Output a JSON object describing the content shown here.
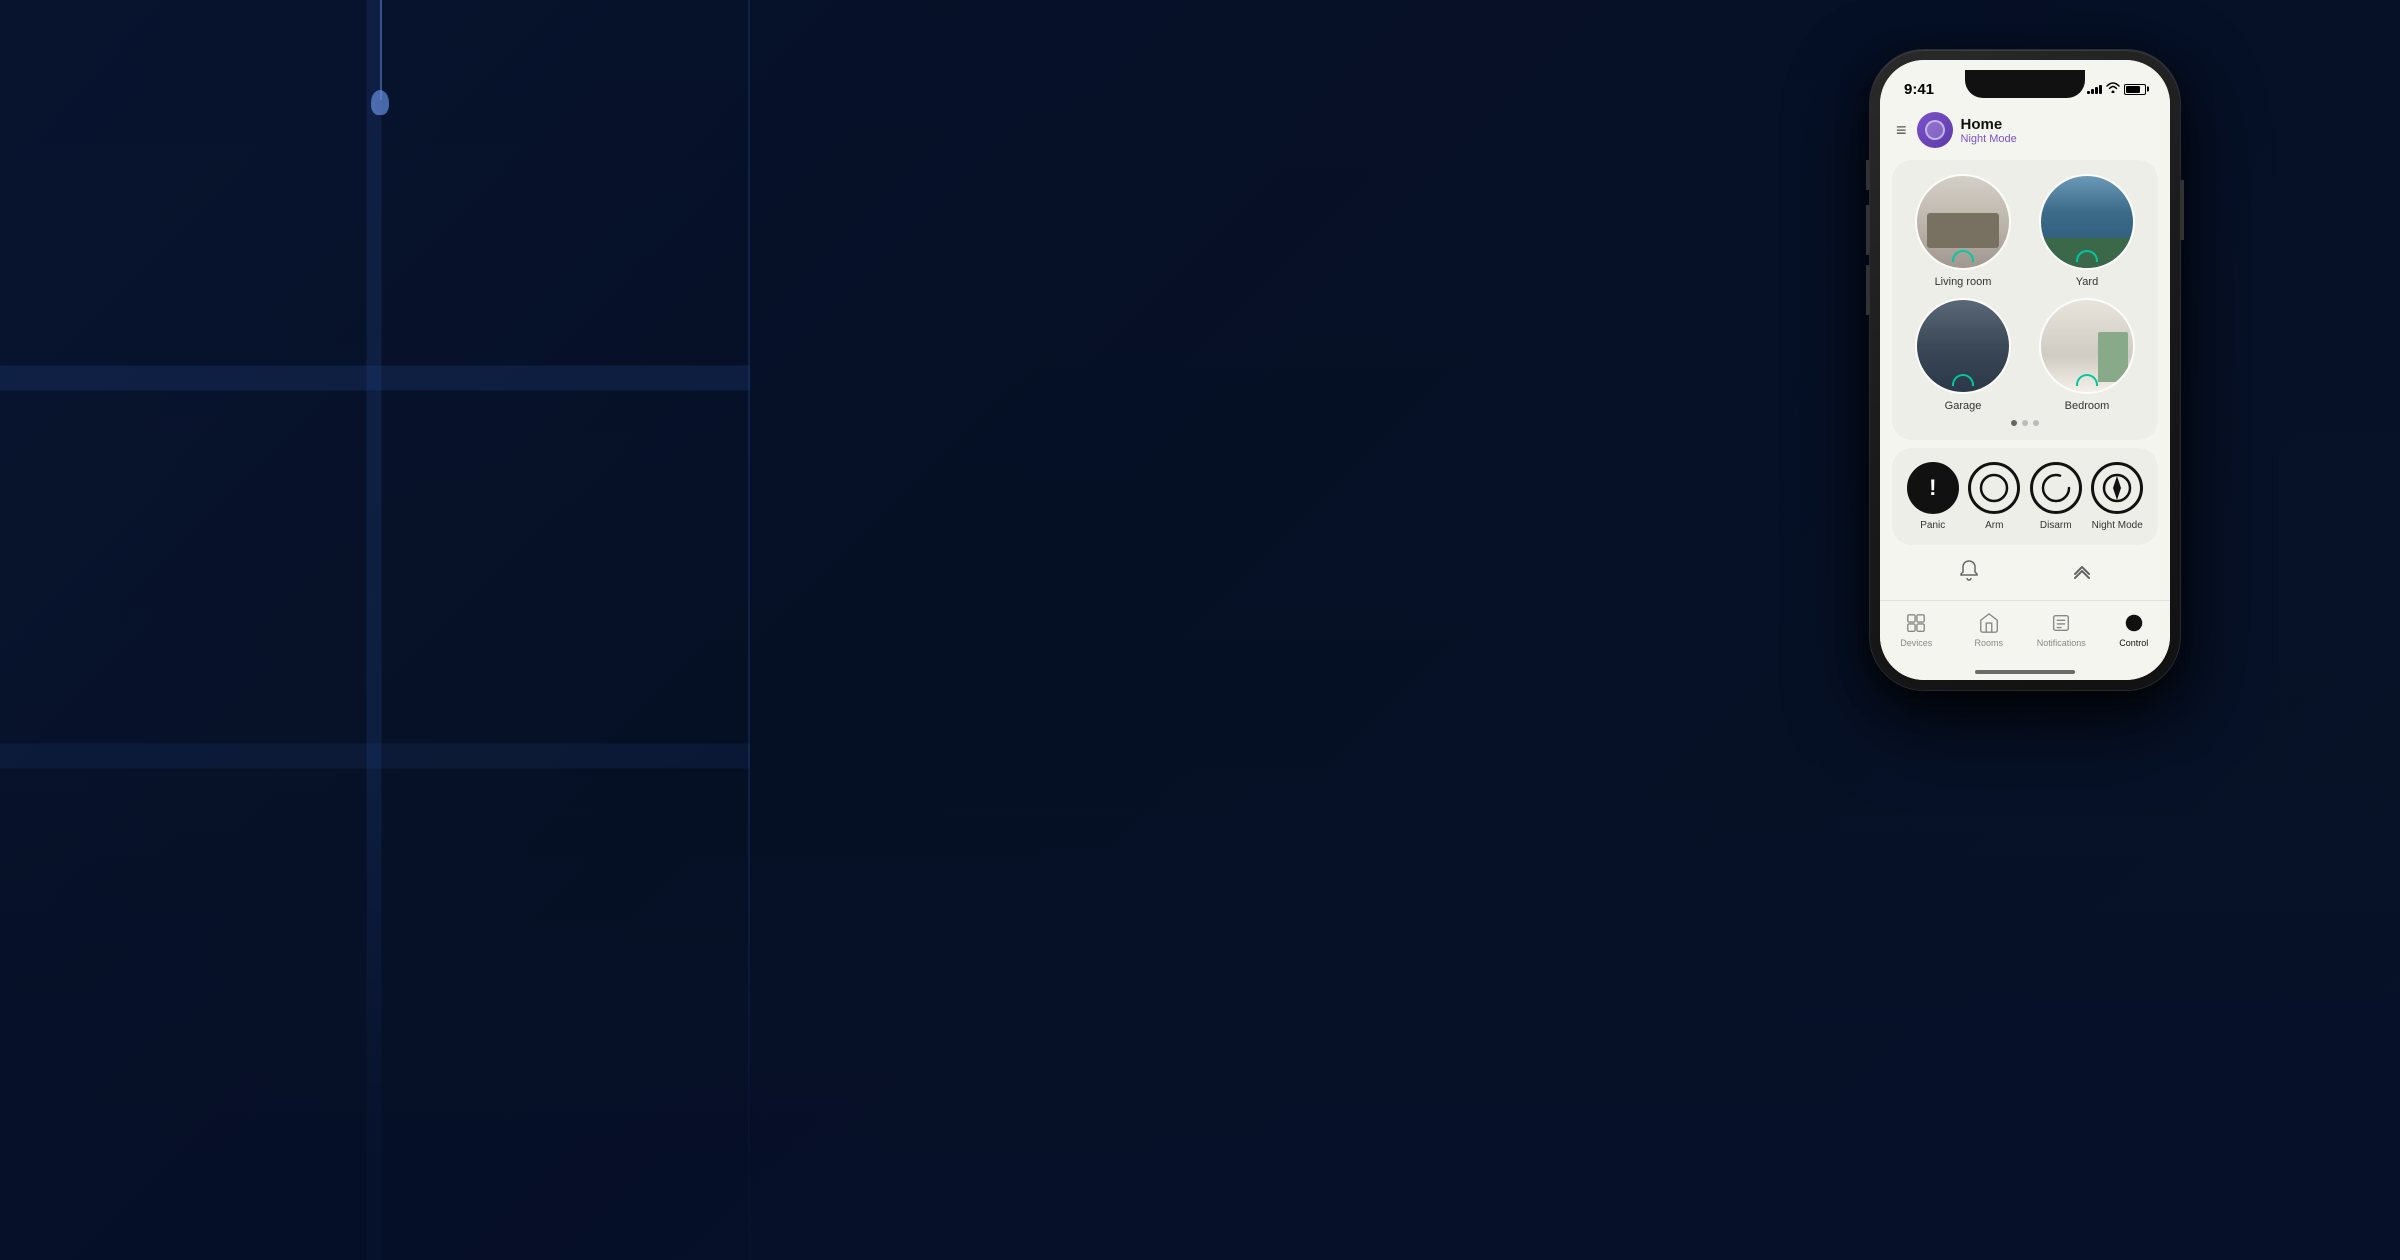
{
  "background": {
    "color": "#0a1628"
  },
  "phone": {
    "status_bar": {
      "time": "9:41",
      "signal": "signal",
      "wifi": "wifi",
      "battery": "battery"
    },
    "header": {
      "title": "Home",
      "subtitle": "Night Mode",
      "menu_icon": "≡"
    },
    "rooms": {
      "items": [
        {
          "name": "Living room",
          "type": "living"
        },
        {
          "name": "Yard",
          "type": "yard"
        },
        {
          "name": "Garage",
          "type": "garage"
        },
        {
          "name": "Bedroom",
          "type": "bedroom"
        }
      ],
      "pagination": [
        true,
        false,
        false
      ]
    },
    "security": {
      "controls": [
        {
          "id": "panic",
          "label": "Panic",
          "icon": "!"
        },
        {
          "id": "arm",
          "label": "Arm",
          "icon": "circle"
        },
        {
          "id": "disarm",
          "label": "Disarm",
          "icon": "arc"
        },
        {
          "id": "night",
          "label": "Night Mode",
          "icon": "arrow-circle"
        }
      ]
    },
    "tabs": [
      {
        "id": "devices",
        "label": "Devices",
        "active": false
      },
      {
        "id": "rooms",
        "label": "Rooms",
        "active": false
      },
      {
        "id": "notifications",
        "label": "Notifications",
        "active": false
      },
      {
        "id": "control",
        "label": "Control",
        "active": true
      }
    ]
  }
}
